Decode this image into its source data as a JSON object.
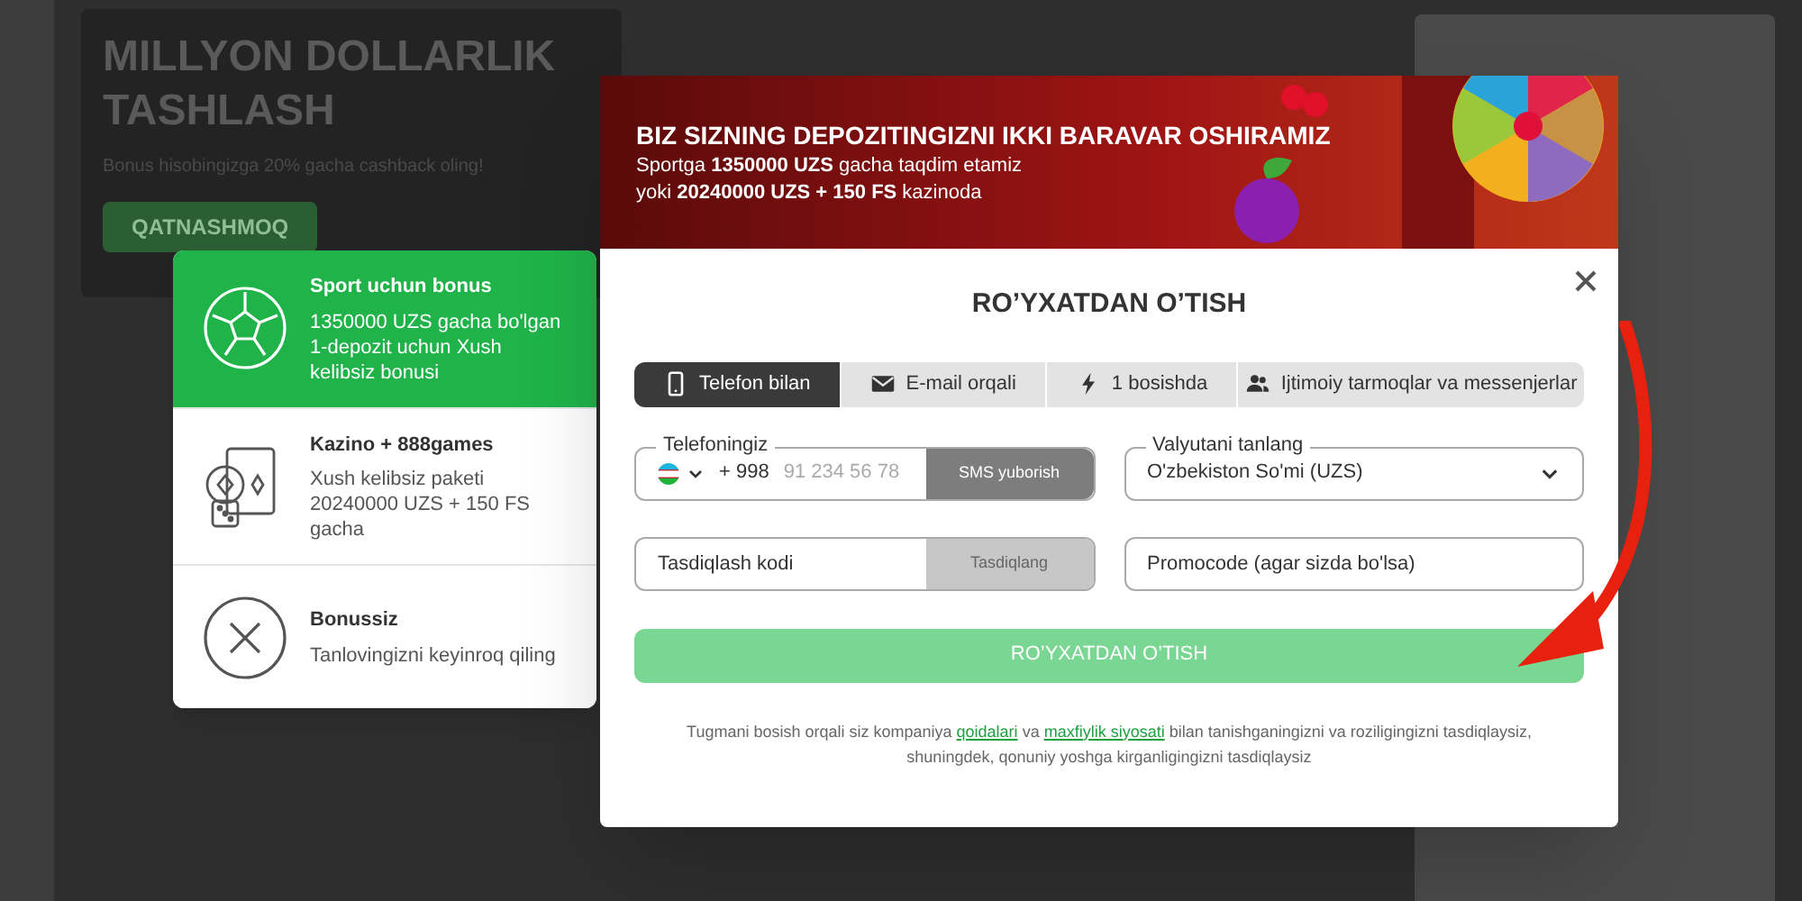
{
  "background": {
    "hero_title": "MILLYON DOLLARLIK TASHLASH",
    "hero_subtitle": "Bonus hisobingizga 20% gacha cashback oling!",
    "hero_button": "QATNASHMOQ"
  },
  "bonus_options": [
    {
      "kind": "sport",
      "title": "Sport uchun bonus",
      "description": "1350000 UZS gacha bo'lgan 1-depozit uchun Xush kelibsiz bonusi",
      "selected": true
    },
    {
      "kind": "casino",
      "title": "Kazino + 888games",
      "description": "Xush kelibsiz paketi 20240000 UZS + 150 FS gacha",
      "selected": false
    },
    {
      "kind": "none",
      "title": "Bonussiz",
      "description": "Tanlovingizni keyinroq qiling",
      "selected": false
    }
  ],
  "banner": {
    "headline": "BIZ SIZNING DEPOZITINGIZNI IKKI BARAVAR OSHIRAMIZ",
    "lines": [
      "Sportga **1350000 UZS** gacha taqdim etamiz",
      "yoki **20240000 UZS + 150 FS** kazinoda"
    ]
  },
  "modal": {
    "title": "RO’YXATDAN O’TISH",
    "tabs": [
      {
        "kind": "phone",
        "label": "Telefon bilan",
        "selected": true
      },
      {
        "kind": "email",
        "label": "E-mail orqali",
        "selected": false
      },
      {
        "kind": "oneclick",
        "label": "1 bosishda",
        "selected": false
      },
      {
        "kind": "social",
        "label": "Ijtimoiy tarmoqlar va messenjerlar",
        "selected": false
      }
    ],
    "phone": {
      "label": "Telefoningiz",
      "prefix": "+ 998",
      "placeholder": "91 234 56 78",
      "button": "SMS yuborish"
    },
    "currency": {
      "label": "Valyutani tanlang",
      "value": "O'zbekiston So'mi (UZS)"
    },
    "code": {
      "placeholder": "Tasdiqlash kodi",
      "button": "Tasdiqlang"
    },
    "promo": {
      "placeholder": "Promocode (agar sizda bo'lsa)"
    },
    "submit": {
      "label": "RO’YXATDAN O’TISH",
      "disabled": true
    },
    "terms": {
      "before": "Tugmani bosish orqali siz kompaniya ",
      "link_1": "qoidalari",
      "middle": " va ",
      "link_2": "maxfiylik siyosati",
      "after": " bilan tanishganingizni va roziligingizni tasdiqlaysiz, shuningdek, qonuniy yoshga kirganligingizni tasdiqlaysiz"
    }
  }
}
